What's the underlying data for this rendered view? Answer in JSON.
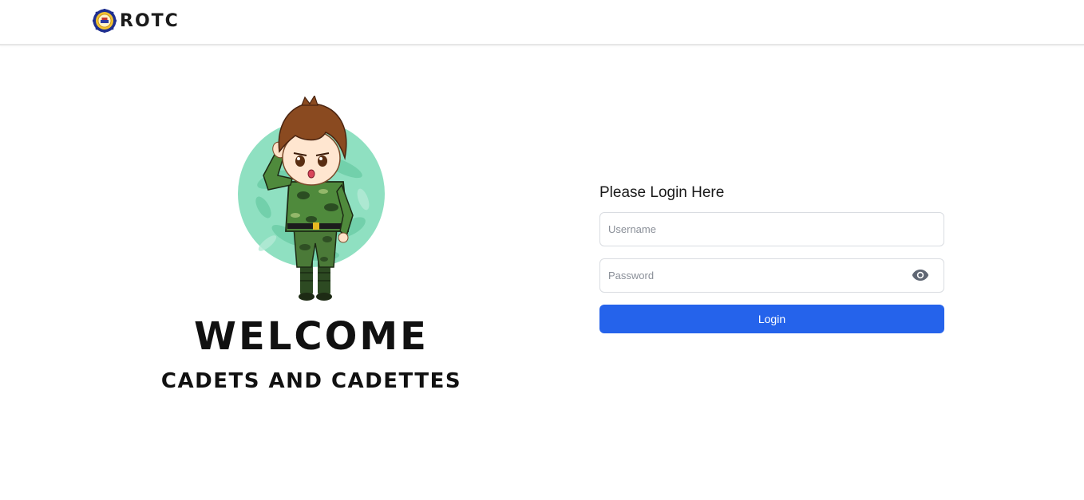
{
  "navbar": {
    "brand_text": "ROTC",
    "logo_icon": "rotc-seal-icon"
  },
  "hero": {
    "illustration": "saluting-cadet-illustration",
    "welcome": "WELCOME",
    "subtitle": "CADETS AND CADETTES"
  },
  "login": {
    "title": "Please Login Here",
    "username_placeholder": "Username",
    "password_placeholder": "Password",
    "toggle_icon": "eye-icon",
    "button_label": "Login"
  },
  "colors": {
    "accent": "#2563eb",
    "camo_circle": "#8fe0c1"
  }
}
